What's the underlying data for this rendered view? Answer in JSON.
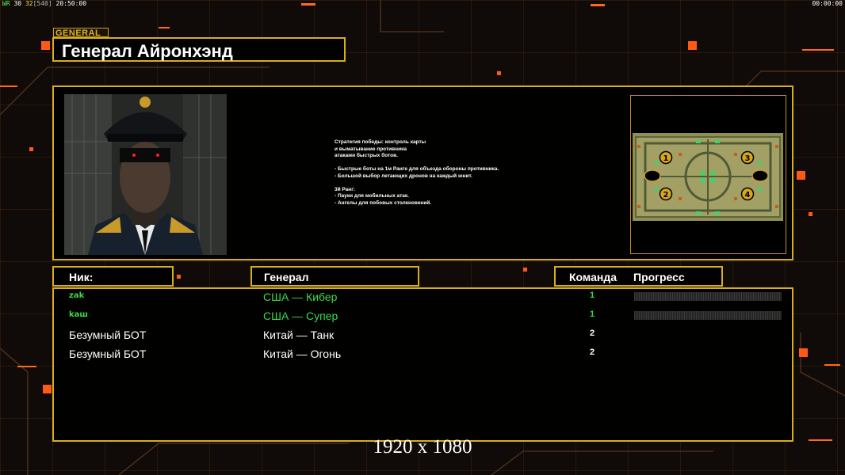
{
  "hud": {
    "prefix": "ЫR",
    "fps": "30",
    "fps_limit": "32",
    "bracket": "[540]",
    "clock": "20:50:00",
    "timer": "00:00:00"
  },
  "general_tag": "GENERAL",
  "title": "Генерал Айронхэнд",
  "description": "Стратегия победы: контроль карты\nи выматывание противника\nатаками быстрых ботов.\n\n- Быстрые боты на 1м Ранге для объезда обороны противника.\n- Большой выбор летающих дронов на каждый юнит.\n\n3й Ранг:\n- Пауки для мобильных атак.\n- Ангелы для побовых столкновений.",
  "map_markers": [
    "1",
    "2",
    "3",
    "4"
  ],
  "headers": {
    "nick": "Ник:",
    "general": "Генерал",
    "team": "Команда",
    "progress": "Прогресс"
  },
  "players": [
    {
      "nick": "zak",
      "general": "США — Кибер",
      "team": "1",
      "has_progress": true,
      "color": "#3bd94b"
    },
    {
      "nick": "kaш",
      "general": "США — Супер",
      "team": "1",
      "has_progress": true,
      "color": "#3bd94b"
    },
    {
      "nick": "Безумный БОТ",
      "general": "Китай — Танк",
      "team": "2",
      "has_progress": false,
      "color": "#ffffff"
    },
    {
      "nick": "Безумный БОТ",
      "general": "Китай — Огонь",
      "team": "2",
      "has_progress": false,
      "color": "#ffffff"
    }
  ],
  "resolution": "1920 x 1080",
  "colors": {
    "frame": "#d8ae1c",
    "accent": "#ff6a1a",
    "player_green": "#3bd94b"
  }
}
